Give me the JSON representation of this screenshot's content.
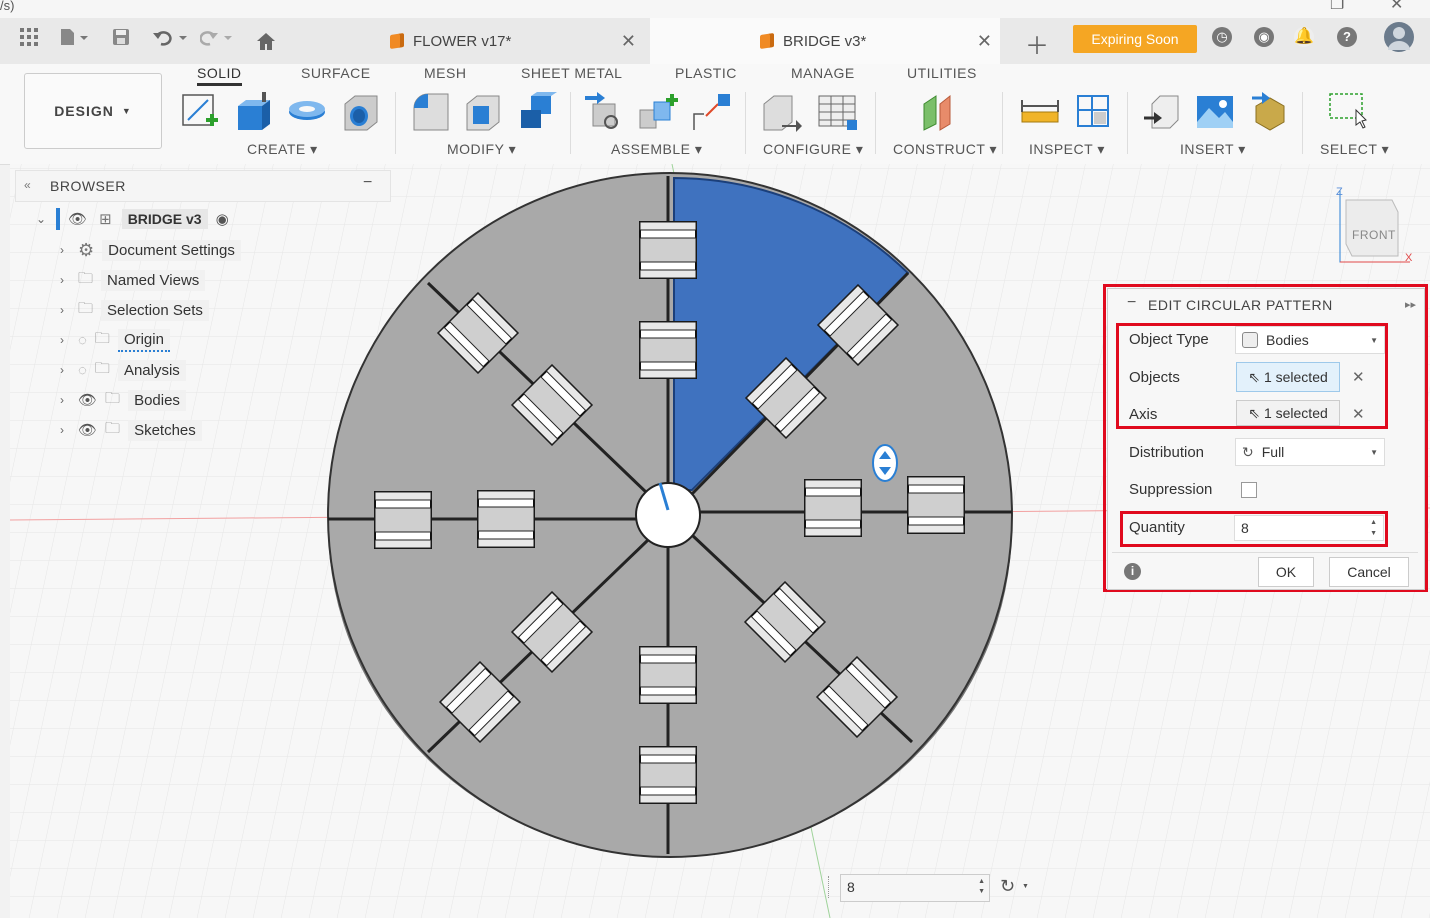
{
  "window": {
    "title_fragment": "/s)"
  },
  "tabs": [
    {
      "label": "FLOWER v17*"
    },
    {
      "label": "BRIDGE v3*"
    }
  ],
  "header": {
    "expiring_label": "Expiring Soon"
  },
  "toolbar": {
    "workspace": "DESIGN",
    "workspace_tabs": [
      "SOLID",
      "SURFACE",
      "MESH",
      "SHEET METAL",
      "PLASTIC",
      "MANAGE",
      "UTILITIES"
    ],
    "groups": [
      "CREATE",
      "MODIFY",
      "ASSEMBLE",
      "CONFIGURE",
      "CONSTRUCT",
      "INSPECT",
      "INSERT",
      "SELECT"
    ]
  },
  "browser": {
    "title": "BROWSER",
    "root": "BRIDGE v3",
    "items": [
      {
        "label": "Document Settings",
        "icon": "gear-icon"
      },
      {
        "label": "Named Views",
        "icon": "folder-icon"
      },
      {
        "label": "Selection Sets",
        "icon": "folder-icon"
      },
      {
        "label": "Origin",
        "icon": "folder-icon",
        "visible": false
      },
      {
        "label": "Analysis",
        "icon": "folder-icon",
        "visible": false
      },
      {
        "label": "Bodies",
        "icon": "folder-icon",
        "visible": true
      },
      {
        "label": "Sketches",
        "icon": "folder-icon",
        "visible": true
      }
    ]
  },
  "viewcube": {
    "face": "FRONT",
    "axis_z": "Z",
    "axis_x": "X"
  },
  "dialog": {
    "title": "EDIT CIRCULAR PATTERN",
    "object_type_label": "Object Type",
    "object_type_value": "Bodies",
    "objects_label": "Objects",
    "objects_value": "1 selected",
    "axis_label": "Axis",
    "axis_value": "1 selected",
    "distribution_label": "Distribution",
    "distribution_value": "Full",
    "suppression_label": "Suppression",
    "quantity_label": "Quantity",
    "quantity_value": "8",
    "ok_label": "OK",
    "cancel_label": "Cancel"
  },
  "canvas_input": {
    "value": "8"
  },
  "colors": {
    "selected_body": "#3f72bf",
    "body": "#a9a9a9",
    "highlight": "#e00a1e",
    "expiring": "#f5a623"
  }
}
